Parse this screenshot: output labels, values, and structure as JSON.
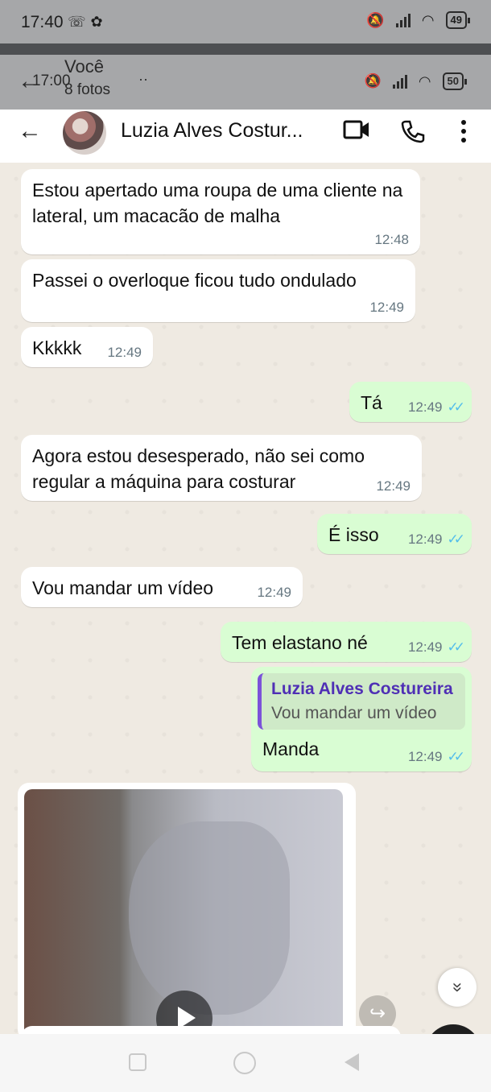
{
  "status_bar": {
    "time": "17:40",
    "battery": "49"
  },
  "overlay_bar": {
    "time": "17:00",
    "title": "Você",
    "subtitle": "8 fotos",
    "battery": "50",
    "more": "··"
  },
  "chat_header": {
    "contact_name": "Luzia Alves Costur..."
  },
  "messages": [
    {
      "direction": "in",
      "text": "Estou apertado uma roupa de uma cliente na lateral, um macacão de malha",
      "time": "12:48"
    },
    {
      "direction": "in",
      "text": "Passei o overloque ficou tudo ondulado",
      "time": "12:49"
    },
    {
      "direction": "in",
      "text": "Kkkkk",
      "time": "12:49"
    },
    {
      "direction": "out",
      "text": "Tá",
      "time": "12:49",
      "ticks": "✓✓"
    },
    {
      "direction": "in",
      "text": "Agora estou desesperado, não sei como regular a máquina para costurar",
      "time": "12:49"
    },
    {
      "direction": "out",
      "text": "É isso",
      "time": "12:49",
      "ticks": "✓✓"
    },
    {
      "direction": "in",
      "text": "Vou mandar um vídeo",
      "time": "12:49"
    },
    {
      "direction": "out",
      "text": "Tem elastano né",
      "time": "12:49",
      "ticks": "✓✓"
    },
    {
      "direction": "out",
      "quote_name": "Luzia Alves Costureira",
      "quote_text": "Vou mandar um vídeo",
      "text": "Manda",
      "time": "12:49",
      "ticks": "✓✓"
    }
  ],
  "icons": {
    "back": "←",
    "video_call": "video-camera-icon",
    "voice_call": "phone-icon",
    "menu": "more-vertical-icon",
    "forward": "↪",
    "scroll_down": "»"
  },
  "colors": {
    "incoming_bubble": "#ffffff",
    "outgoing_bubble": "#d9fdd3",
    "chat_background": "#efeae2",
    "quote_accent": "#7b52d9",
    "read_ticks": "#53bdeb"
  }
}
